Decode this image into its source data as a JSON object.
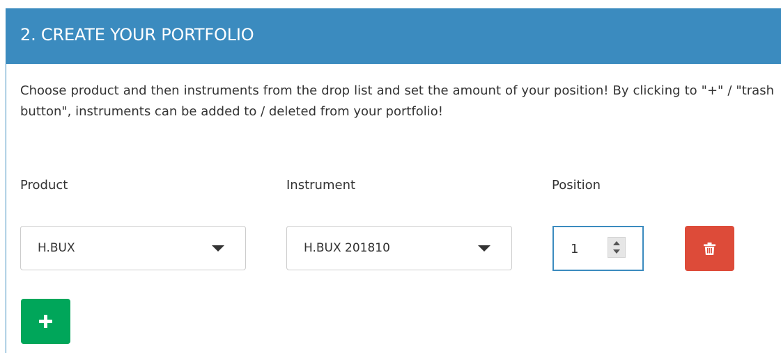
{
  "panel": {
    "title": "2. CREATE YOUR PORTFOLIO",
    "header_color": "#3b8bbf"
  },
  "intro_text": "Choose product and then instruments from the drop list and set the amount of your position! By clicking to \"+\" / \"trash button\", instruments can be added to / deleted from your portfolio!",
  "columns": {
    "product_label": "Product",
    "instrument_label": "Instrument",
    "position_label": "Position"
  },
  "rows": [
    {
      "product": "H.BUX",
      "instrument": "H.BUX 201810",
      "position": "1"
    }
  ],
  "icons": {
    "product_caret": "chevron-down-icon",
    "instrument_caret": "chevron-down-icon",
    "delete": "trash-icon",
    "add": "plus-icon"
  },
  "colors": {
    "accent": "#3b8bbf",
    "danger": "#dd4b39",
    "success": "#00a65a"
  }
}
